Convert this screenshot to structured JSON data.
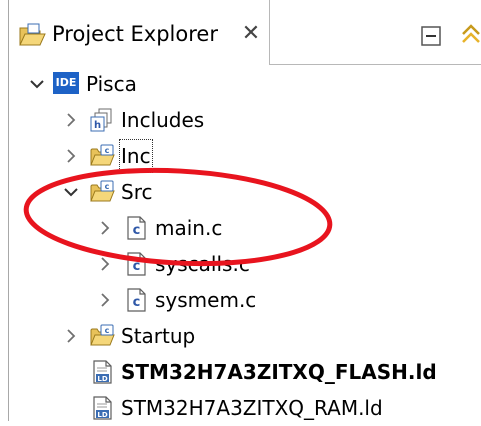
{
  "view": {
    "tab_title": "Project Explorer",
    "tab_icon": "project-explorer-icon",
    "close_icon": "close-icon",
    "toolbar": [
      {
        "name": "collapse-all-icon"
      },
      {
        "name": "link-with-editor-icon"
      }
    ]
  },
  "tree": {
    "project": {
      "label": "Pisca",
      "icon": "ide-project-icon",
      "expanded": true
    },
    "items": [
      {
        "label": "Includes",
        "icon": "includes-icon",
        "expanded": false
      },
      {
        "label": "Inc",
        "icon": "source-folder-icon",
        "expanded": false
      },
      {
        "label": "Src",
        "icon": "source-folder-icon",
        "expanded": true,
        "children": [
          {
            "label": "main.c",
            "icon": "c-file-icon"
          },
          {
            "label": "syscalls.c",
            "icon": "c-file-icon"
          },
          {
            "label": "sysmem.c",
            "icon": "c-file-icon"
          }
        ]
      },
      {
        "label": "Startup",
        "icon": "source-folder-icon",
        "expanded": false
      },
      {
        "label": "STM32H7A3ZITXQ_FLASH.ld",
        "icon": "linker-script-icon"
      },
      {
        "label": "STM32H7A3ZITXQ_RAM.ld",
        "icon": "linker-script-icon"
      }
    ]
  },
  "annotation": {
    "shape": "ellipse",
    "color": "#e8141e"
  }
}
